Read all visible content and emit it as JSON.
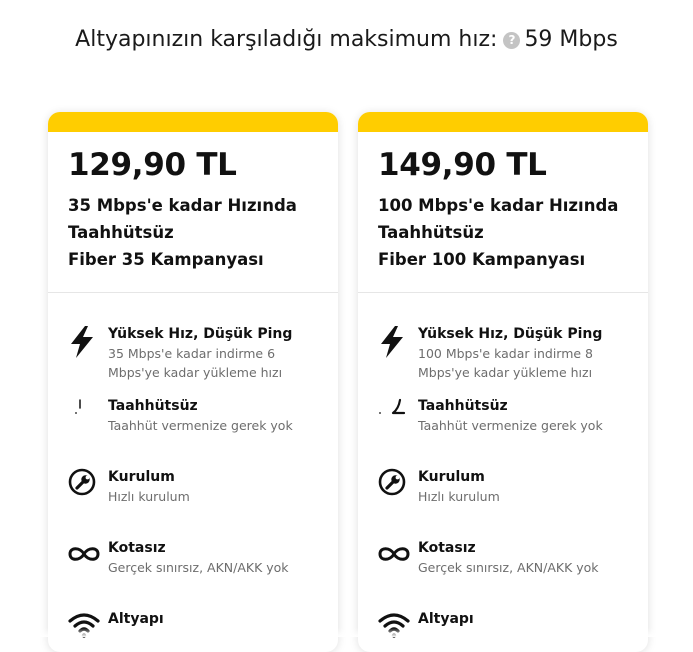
{
  "header": {
    "label": "Altyapınızın karşıladığı maksimum hız:",
    "help_symbol": "?",
    "speed": "59 Mbps"
  },
  "colors": {
    "accent": "#ffcd00",
    "text": "#111111",
    "muted": "#6d6d6d",
    "help_icon": "#c4c4c4"
  },
  "plans": [
    {
      "price": "129,90 TL",
      "title_lines": [
        "35 Mbps'e kadar Hızında",
        "Taahhütsüz",
        "Fiber 35 Kampanyası"
      ],
      "features": [
        {
          "icon": "lightning-icon",
          "title": "Yüksek Hız, Düşük Ping",
          "desc": "35 Mbps'e kadar indirme 6 Mbps'ye kadar yükleme hızı"
        },
        {
          "icon": "no-commitment-icon",
          "title": "Taahhütsüz",
          "desc": "Taahhüt vermenize gerek yok"
        },
        {
          "icon": "wrench-icon",
          "title": "Kurulum",
          "desc": "Hızlı kurulum"
        },
        {
          "icon": "infinity-icon",
          "title": "Kotasız",
          "desc": "Gerçek sınırsız, AKN/AKK yok"
        },
        {
          "icon": "wifi-icon",
          "title": "Altyapı",
          "desc": ""
        }
      ]
    },
    {
      "price": "149,90 TL",
      "title_lines": [
        "100 Mbps'e kadar Hızında",
        "Taahhütsüz",
        "Fiber 100 Kampanyası"
      ],
      "features": [
        {
          "icon": "lightning-icon",
          "title": "Yüksek Hız, Düşük Ping",
          "desc": "100 Mbps'e kadar indirme 8 Mbps'ye kadar yükleme hızı"
        },
        {
          "icon": "no-commitment-icon",
          "title": "Taahhütsüz",
          "desc": "Taahhüt vermenize gerek yok"
        },
        {
          "icon": "wrench-icon",
          "title": "Kurulum",
          "desc": "Hızlı kurulum"
        },
        {
          "icon": "infinity-icon",
          "title": "Kotasız",
          "desc": "Gerçek sınırsız, AKN/AKK yok"
        },
        {
          "icon": "wifi-icon",
          "title": "Altyapı",
          "desc": ""
        }
      ]
    }
  ]
}
